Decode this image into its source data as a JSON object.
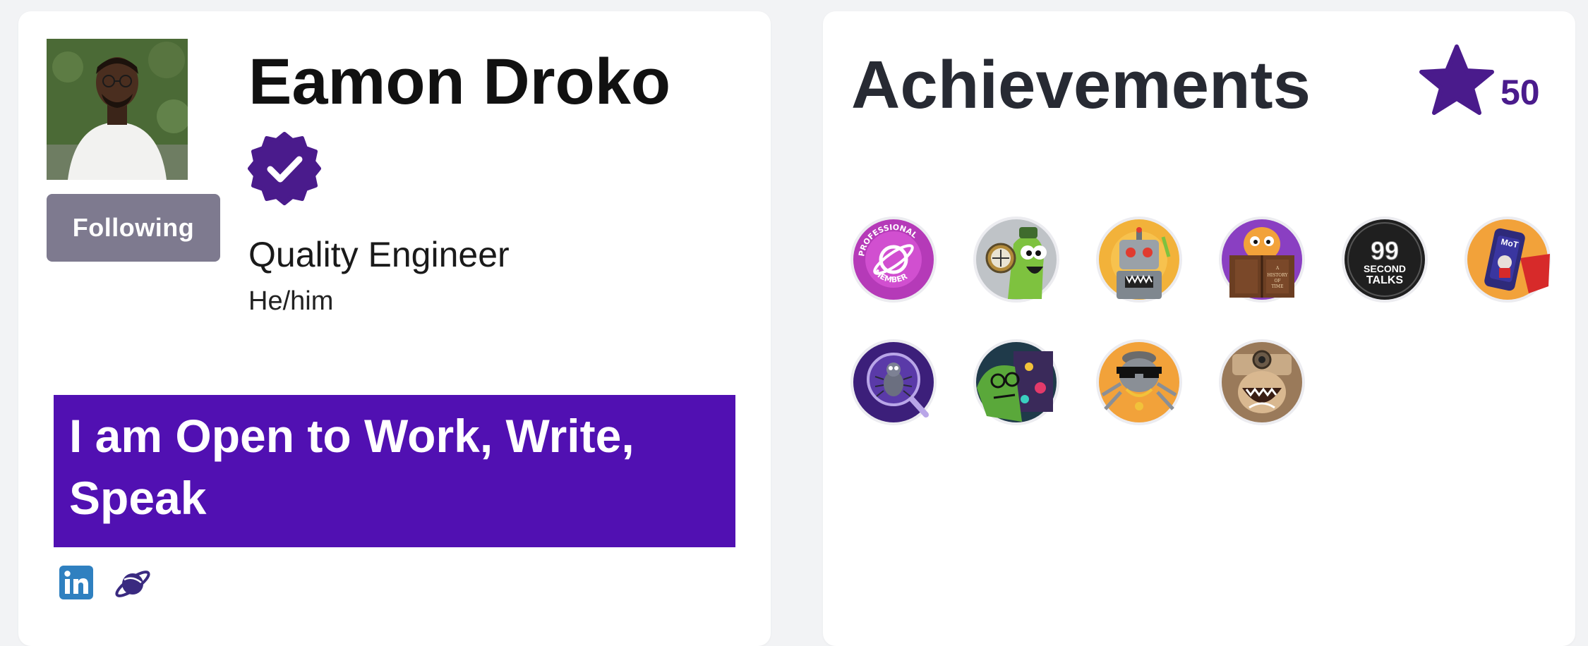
{
  "profile": {
    "name": "Eamon Droko",
    "job_title": "Quality Engineer",
    "pronouns": "He/him",
    "follow_button_label": "Following",
    "verified_icon": "verified-badge-icon",
    "banner_text": "I am Open to Work, Write, Speak",
    "links": [
      {
        "name": "linkedin-icon",
        "label": "in"
      },
      {
        "name": "planet-icon"
      }
    ]
  },
  "achievements": {
    "title": "Achievements",
    "points": "50",
    "star_icon": "star-icon",
    "badges": [
      {
        "name": "badge-professional-member",
        "label": "PROFESSIONAL MEMBER"
      },
      {
        "name": "badge-green-monster-compass"
      },
      {
        "name": "badge-robot"
      },
      {
        "name": "badge-history-of-time",
        "label": "A HISTORY OF TIME"
      },
      {
        "name": "badge-99-second-talks",
        "label": "99 SECOND TALKS"
      },
      {
        "name": "badge-phone-mot",
        "label": "MoT"
      },
      {
        "name": "badge-bug-magnifier"
      },
      {
        "name": "badge-green-monster-glasses"
      },
      {
        "name": "badge-cool-bug-sunglasses"
      },
      {
        "name": "badge-camera-monster"
      }
    ]
  },
  "colors": {
    "brand_purple": "#5110b2",
    "star_purple": "#4a1b8c",
    "button_gray": "#7e7a8f"
  }
}
